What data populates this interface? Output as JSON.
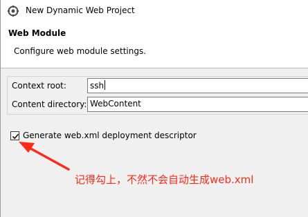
{
  "window": {
    "title": "New Dynamic Web Project",
    "icon": "project-gear-icon"
  },
  "banner": {
    "title": "Web Module",
    "description": "Configure web module settings."
  },
  "form": {
    "context_root_label": "Context root:",
    "context_root_value": "ssh",
    "content_directory_label": "Content directory:",
    "content_directory_value": "WebContent",
    "generate_xml_label": "Generate web.xml deployment descriptor",
    "generate_xml_checked": true
  },
  "annotation": {
    "text": "记得勾上，不然不会自动生成web.xml",
    "color": "#ff2a1a",
    "icon": "red-arrow-icon"
  }
}
